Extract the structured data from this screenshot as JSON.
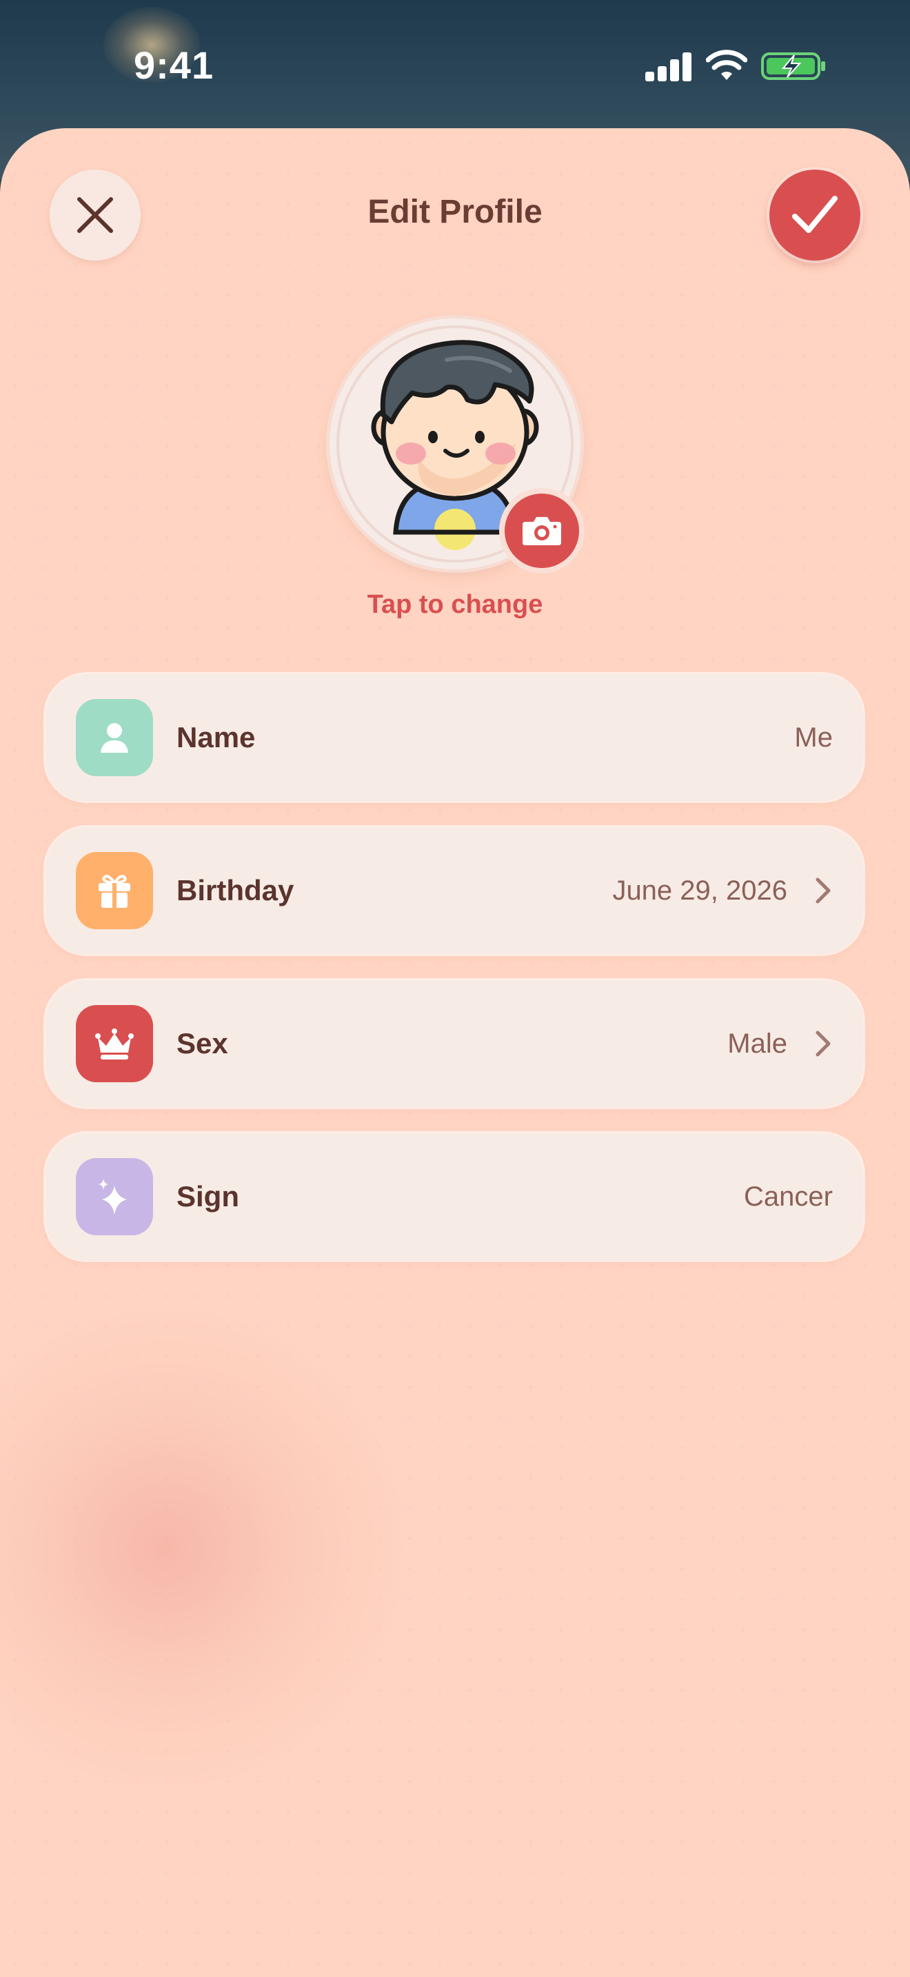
{
  "status_bar": {
    "time": "9:41"
  },
  "header": {
    "title": "Edit Profile",
    "close_icon": "close-icon",
    "confirm_icon": "checkmark-icon"
  },
  "avatar": {
    "change_label": "Tap to change",
    "camera_icon": "camera-icon"
  },
  "fields": [
    {
      "label": "Name",
      "value": "Me",
      "icon": "person-icon",
      "color": "#9fdcc6",
      "chevron": false
    },
    {
      "label": "Birthday",
      "value": "June 29, 2026",
      "icon": "gift-icon",
      "color": "#ffb06b",
      "chevron": true
    },
    {
      "label": "Sex",
      "value": "Male",
      "icon": "crown-icon",
      "color": "#d94f50",
      "chevron": true
    },
    {
      "label": "Sign",
      "value": "Cancer",
      "icon": "sparkle-icon",
      "color": "#c8b7e6",
      "chevron": false
    }
  ],
  "colors": {
    "accent": "#d94f50",
    "sheet": "#ffd4c2",
    "row_bg": "#f7ebe5",
    "text_primary": "#5b342d",
    "text_secondary": "#8a6058"
  }
}
